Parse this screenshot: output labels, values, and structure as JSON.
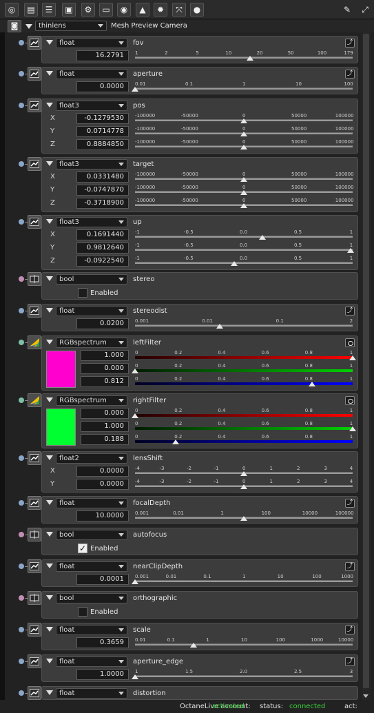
{
  "toolbar": {
    "icons": [
      "node-graph-icon",
      "stack-icon",
      "list-icon",
      "render-view-icon",
      "camera-gear-icon",
      "panel-icon",
      "database-icon",
      "image-icon",
      "sun-icon",
      "expand-icon",
      "material-drop-icon",
      "wrench-icon",
      "expand-arrows-icon"
    ]
  },
  "header": {
    "type_value": "thinlens",
    "title": "Mesh Preview Camera"
  },
  "params": [
    {
      "type": "float",
      "name": "fov",
      "values": [
        "16.2791"
      ],
      "ticks": [
        "1",
        "2",
        "5",
        "10",
        "20",
        "50",
        "100",
        "179"
      ],
      "thumb_value": 16.2791
    },
    {
      "type": "float",
      "name": "aperture",
      "values": [
        "0.0000"
      ],
      "ticks": [
        "0.01",
        "0.1",
        "1",
        "10",
        "100"
      ],
      "thumb_value": 0.0
    },
    {
      "type": "float3",
      "name": "pos",
      "labels": [
        "X",
        "Y",
        "Z"
      ],
      "values": [
        "-0.1279530",
        "0.0714778",
        "0.8884850"
      ],
      "ticks": [
        "-100000",
        "-50000",
        "0",
        "50000",
        "100000"
      ]
    },
    {
      "type": "float3",
      "name": "target",
      "labels": [
        "X",
        "Y",
        "Z"
      ],
      "values": [
        "0.0331480",
        "-0.0747870",
        "-0.3718900"
      ],
      "ticks": [
        "-100000",
        "-50000",
        "0",
        "50000",
        "100000"
      ]
    },
    {
      "type": "float3",
      "name": "up",
      "labels": [
        "X",
        "Y",
        "Z"
      ],
      "values": [
        "0.1691440",
        "0.9812640",
        "-0.0922540"
      ],
      "ticks": [
        "-1",
        "-0.5",
        "0.0",
        "0.5",
        "1"
      ]
    },
    {
      "type": "bool",
      "name": "stereo",
      "checked": false,
      "check_label": "Enabled"
    },
    {
      "type": "float",
      "name": "stereodist",
      "values": [
        "0.0200"
      ],
      "ticks": [
        "0.001",
        "0.01",
        "0.1",
        "2"
      ],
      "thumb_value": 0.02
    },
    {
      "type": "RGBspectrum",
      "name": "leftFilter",
      "values": [
        "1.000",
        "0.000",
        "0.812"
      ],
      "ticks": [
        "0",
        "0.2",
        "0.4",
        "0.6",
        "0.8",
        "1"
      ],
      "swatch_color": "#ff00cf"
    },
    {
      "type": "RGBspectrum",
      "name": "rightFilter",
      "values": [
        "0.000",
        "1.000",
        "0.188"
      ],
      "ticks": [
        "0",
        "0.2",
        "0.4",
        "0.6",
        "0.8",
        "1"
      ],
      "swatch_color": "#00ff30"
    },
    {
      "type": "float2",
      "name": "lensShift",
      "labels": [
        "X",
        "Y"
      ],
      "values": [
        "0.0000",
        "0.0000"
      ],
      "ticks": [
        "-4",
        "-3",
        "-2",
        "-1",
        "0",
        "1",
        "2",
        "3",
        "4"
      ]
    },
    {
      "type": "float",
      "name": "focalDepth",
      "values": [
        "10.0000"
      ],
      "ticks": [
        "0.001",
        "0.01",
        "1",
        "100",
        "10000",
        "100000"
      ],
      "thumb_value": 10.0
    },
    {
      "type": "bool",
      "name": "autofocus",
      "checked": true,
      "check_label": "Enabled"
    },
    {
      "type": "float",
      "name": "nearClipDepth",
      "values": [
        "0.0001"
      ],
      "ticks": [
        "0.001",
        "0.01",
        "0.1",
        "1",
        "10",
        "100",
        "1000"
      ],
      "thumb_value": 0.0001
    },
    {
      "type": "bool",
      "name": "orthographic",
      "checked": false,
      "check_label": "Enabled"
    },
    {
      "type": "float",
      "name": "scale",
      "values": [
        "0.3659"
      ],
      "ticks": [
        "0.01",
        "0.1",
        "1",
        "10",
        "100",
        "1000",
        "10000"
      ],
      "thumb_value": 0.3659
    },
    {
      "type": "float",
      "name": "aperture_edge",
      "values": [
        "1.0000"
      ],
      "ticks": [
        "1",
        "1.5",
        "2.0",
        "2.5",
        "3"
      ],
      "thumb_value": 1.0
    },
    {
      "type": "float",
      "name": "distortion",
      "values": []
    }
  ],
  "status": {
    "account_label": "OctaneLive account:",
    "account_value": "activated",
    "status_label": "status:",
    "status_value": "connected",
    "act_label": "act:"
  },
  "colors": {
    "accent_green": "#39d13a",
    "node_dot_float": "#8aa6c8",
    "node_dot_bool": "#c38eb5",
    "node_dot_rgb": "#7dbfa8"
  }
}
